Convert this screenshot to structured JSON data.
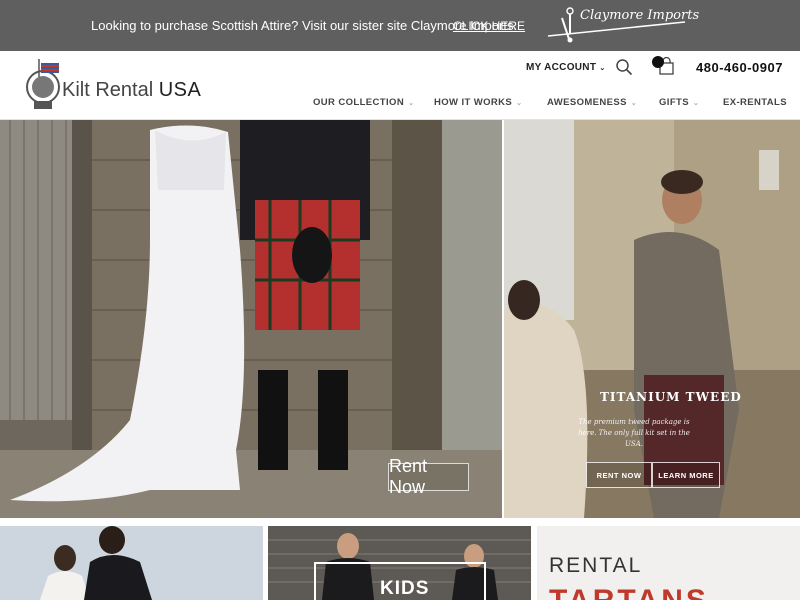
{
  "topbar": {
    "promo_text": "Looking to purchase Scottish Attire? Visit our sister site Claymore Imports.",
    "click_label": "CLICK HERE",
    "claymore_logo_text": "Claymore Imports"
  },
  "header": {
    "logo_text_a": "Kilt Rental",
    "logo_text_b": "USA",
    "account_label": "MY ACCOUNT",
    "phone": "480-460-0907"
  },
  "nav": {
    "items": [
      {
        "label": "OUR COLLECTION"
      },
      {
        "label": "HOW IT WORKS"
      },
      {
        "label": "AWESOMENESS"
      },
      {
        "label": "GIFTS"
      },
      {
        "label": "EX-RENTALS"
      }
    ]
  },
  "hero_left": {
    "button_label": "Rent Now"
  },
  "hero_right": {
    "title": "TITANIUM TWEED",
    "subtitle": "The premium tweed package is here. The only full kit set in the USA.",
    "rent_label": "RENT NOW",
    "learn_label": "LEARN MORE"
  },
  "tiles": {
    "kids_label": "KIDS",
    "rental_label": "RENTAL",
    "tartans_label": "TARTANS"
  },
  "colors": {
    "topbar_bg": "#5f5f5f",
    "header_bg": "#ffffff",
    "accent_red": "#c0392b"
  },
  "icons": {
    "search": "search-icon",
    "cart": "cart-icon",
    "chevron": "chevron-down-icon",
    "sword": "sword-icon",
    "crest": "crest-icon"
  }
}
